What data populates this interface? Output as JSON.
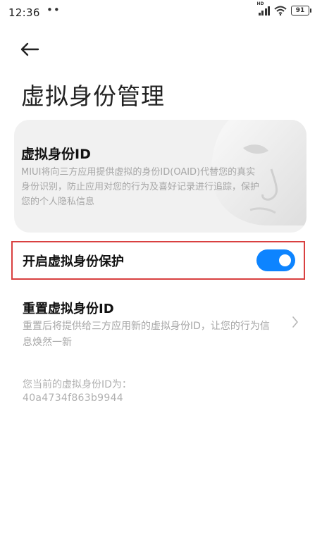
{
  "status_bar": {
    "time": "12:36",
    "dots": "••",
    "signal_label": "HD",
    "battery": "91"
  },
  "header": {
    "title": "虚拟身份管理"
  },
  "id_card": {
    "title": "虚拟身份ID",
    "description": "MIUI将向三方应用提供虚拟的身份ID(OAID)代替您的真实身份识别，防止应用对您的行为及喜好记录进行追踪，保护您的个人隐私信息"
  },
  "protection_toggle": {
    "label": "开启虚拟身份保护",
    "enabled": true,
    "accent_color": "#0d84ff",
    "highlight_color": "#d94040"
  },
  "reset": {
    "title": "重置虚拟身份ID",
    "description": "重置后将提供给三方应用新的虚拟身份ID，让您的行为信息焕然一新"
  },
  "current_id": {
    "label": "您当前的虚拟身份ID为：",
    "value": "40a4734f863b9944"
  }
}
